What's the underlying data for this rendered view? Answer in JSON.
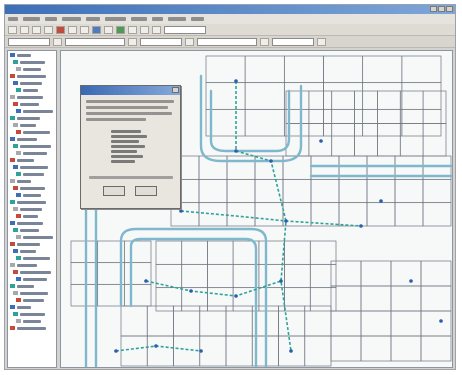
{
  "window": {
    "title": "",
    "colors": {
      "titlebar_start": "#3d6fb8",
      "titlebar_end": "#7fa6d8",
      "chrome": "#d6d3ce",
      "map_background": "#f7f8f8",
      "parcel_lines": "#6d7680",
      "road_outline": "#7fb8cc",
      "pipe_network": "#2fa39a",
      "network_nodes": "#2a5fb0"
    }
  },
  "menu": {
    "items": [
      "",
      "",
      "",
      "",
      "",
      "",
      "",
      "",
      "",
      ""
    ]
  },
  "toolbars": {
    "row1_icons": [
      "new-icon",
      "open-icon",
      "save-icon",
      "print-icon",
      "cut-icon",
      "copy-icon",
      "paste-icon",
      "undo-icon",
      "zoom-in-icon",
      "zoom-out-icon",
      "pan-icon",
      "identify-icon",
      "select-icon"
    ],
    "row2_combos": [
      "",
      "",
      "",
      "",
      ""
    ]
  },
  "layer_tree": {
    "items": [
      "",
      "",
      "",
      "",
      "",
      "",
      "",
      "",
      "",
      "",
      "",
      "",
      "",
      "",
      "",
      "",
      "",
      "",
      "",
      "",
      "",
      "",
      "",
      "",
      "",
      "",
      "",
      "",
      "",
      "",
      "",
      "",
      "",
      "",
      "",
      "",
      "",
      "",
      "",
      ""
    ]
  },
  "dialog": {
    "title": "",
    "ok_label": "",
    "cancel_label": ""
  }
}
